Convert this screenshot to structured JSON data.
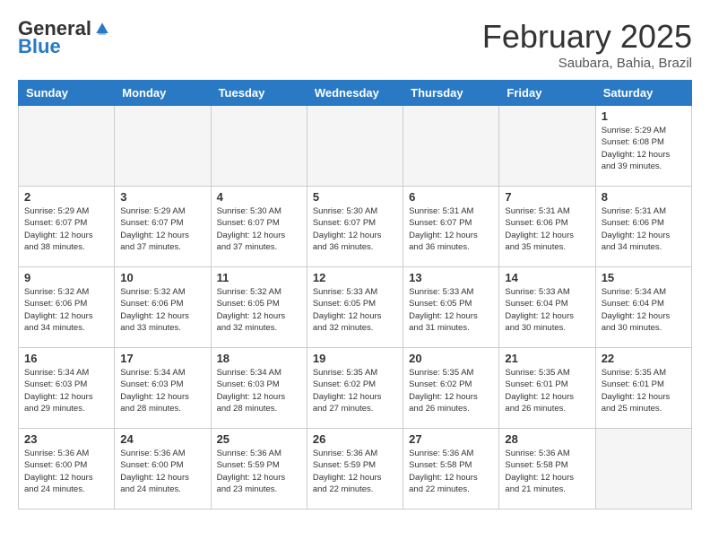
{
  "header": {
    "logo_general": "General",
    "logo_blue": "Blue",
    "title": "February 2025",
    "subtitle": "Saubara, Bahia, Brazil"
  },
  "days_of_week": [
    "Sunday",
    "Monday",
    "Tuesday",
    "Wednesday",
    "Thursday",
    "Friday",
    "Saturday"
  ],
  "weeks": [
    [
      {
        "day": "",
        "info": "",
        "empty": true
      },
      {
        "day": "",
        "info": "",
        "empty": true
      },
      {
        "day": "",
        "info": "",
        "empty": true
      },
      {
        "day": "",
        "info": "",
        "empty": true
      },
      {
        "day": "",
        "info": "",
        "empty": true
      },
      {
        "day": "",
        "info": "",
        "empty": true
      },
      {
        "day": "1",
        "info": "Sunrise: 5:29 AM\nSunset: 6:08 PM\nDaylight: 12 hours and 39 minutes."
      }
    ],
    [
      {
        "day": "2",
        "info": "Sunrise: 5:29 AM\nSunset: 6:07 PM\nDaylight: 12 hours and 38 minutes."
      },
      {
        "day": "3",
        "info": "Sunrise: 5:29 AM\nSunset: 6:07 PM\nDaylight: 12 hours and 37 minutes."
      },
      {
        "day": "4",
        "info": "Sunrise: 5:30 AM\nSunset: 6:07 PM\nDaylight: 12 hours and 37 minutes."
      },
      {
        "day": "5",
        "info": "Sunrise: 5:30 AM\nSunset: 6:07 PM\nDaylight: 12 hours and 36 minutes."
      },
      {
        "day": "6",
        "info": "Sunrise: 5:31 AM\nSunset: 6:07 PM\nDaylight: 12 hours and 36 minutes."
      },
      {
        "day": "7",
        "info": "Sunrise: 5:31 AM\nSunset: 6:06 PM\nDaylight: 12 hours and 35 minutes."
      },
      {
        "day": "8",
        "info": "Sunrise: 5:31 AM\nSunset: 6:06 PM\nDaylight: 12 hours and 34 minutes."
      }
    ],
    [
      {
        "day": "9",
        "info": "Sunrise: 5:32 AM\nSunset: 6:06 PM\nDaylight: 12 hours and 34 minutes."
      },
      {
        "day": "10",
        "info": "Sunrise: 5:32 AM\nSunset: 6:06 PM\nDaylight: 12 hours and 33 minutes."
      },
      {
        "day": "11",
        "info": "Sunrise: 5:32 AM\nSunset: 6:05 PM\nDaylight: 12 hours and 32 minutes."
      },
      {
        "day": "12",
        "info": "Sunrise: 5:33 AM\nSunset: 6:05 PM\nDaylight: 12 hours and 32 minutes."
      },
      {
        "day": "13",
        "info": "Sunrise: 5:33 AM\nSunset: 6:05 PM\nDaylight: 12 hours and 31 minutes."
      },
      {
        "day": "14",
        "info": "Sunrise: 5:33 AM\nSunset: 6:04 PM\nDaylight: 12 hours and 30 minutes."
      },
      {
        "day": "15",
        "info": "Sunrise: 5:34 AM\nSunset: 6:04 PM\nDaylight: 12 hours and 30 minutes."
      }
    ],
    [
      {
        "day": "16",
        "info": "Sunrise: 5:34 AM\nSunset: 6:03 PM\nDaylight: 12 hours and 29 minutes."
      },
      {
        "day": "17",
        "info": "Sunrise: 5:34 AM\nSunset: 6:03 PM\nDaylight: 12 hours and 28 minutes."
      },
      {
        "day": "18",
        "info": "Sunrise: 5:34 AM\nSunset: 6:03 PM\nDaylight: 12 hours and 28 minutes."
      },
      {
        "day": "19",
        "info": "Sunrise: 5:35 AM\nSunset: 6:02 PM\nDaylight: 12 hours and 27 minutes."
      },
      {
        "day": "20",
        "info": "Sunrise: 5:35 AM\nSunset: 6:02 PM\nDaylight: 12 hours and 26 minutes."
      },
      {
        "day": "21",
        "info": "Sunrise: 5:35 AM\nSunset: 6:01 PM\nDaylight: 12 hours and 26 minutes."
      },
      {
        "day": "22",
        "info": "Sunrise: 5:35 AM\nSunset: 6:01 PM\nDaylight: 12 hours and 25 minutes."
      }
    ],
    [
      {
        "day": "23",
        "info": "Sunrise: 5:36 AM\nSunset: 6:00 PM\nDaylight: 12 hours and 24 minutes."
      },
      {
        "day": "24",
        "info": "Sunrise: 5:36 AM\nSunset: 6:00 PM\nDaylight: 12 hours and 24 minutes."
      },
      {
        "day": "25",
        "info": "Sunrise: 5:36 AM\nSunset: 5:59 PM\nDaylight: 12 hours and 23 minutes."
      },
      {
        "day": "26",
        "info": "Sunrise: 5:36 AM\nSunset: 5:59 PM\nDaylight: 12 hours and 22 minutes."
      },
      {
        "day": "27",
        "info": "Sunrise: 5:36 AM\nSunset: 5:58 PM\nDaylight: 12 hours and 22 minutes."
      },
      {
        "day": "28",
        "info": "Sunrise: 5:36 AM\nSunset: 5:58 PM\nDaylight: 12 hours and 21 minutes."
      },
      {
        "day": "",
        "info": "",
        "empty": true
      }
    ]
  ]
}
